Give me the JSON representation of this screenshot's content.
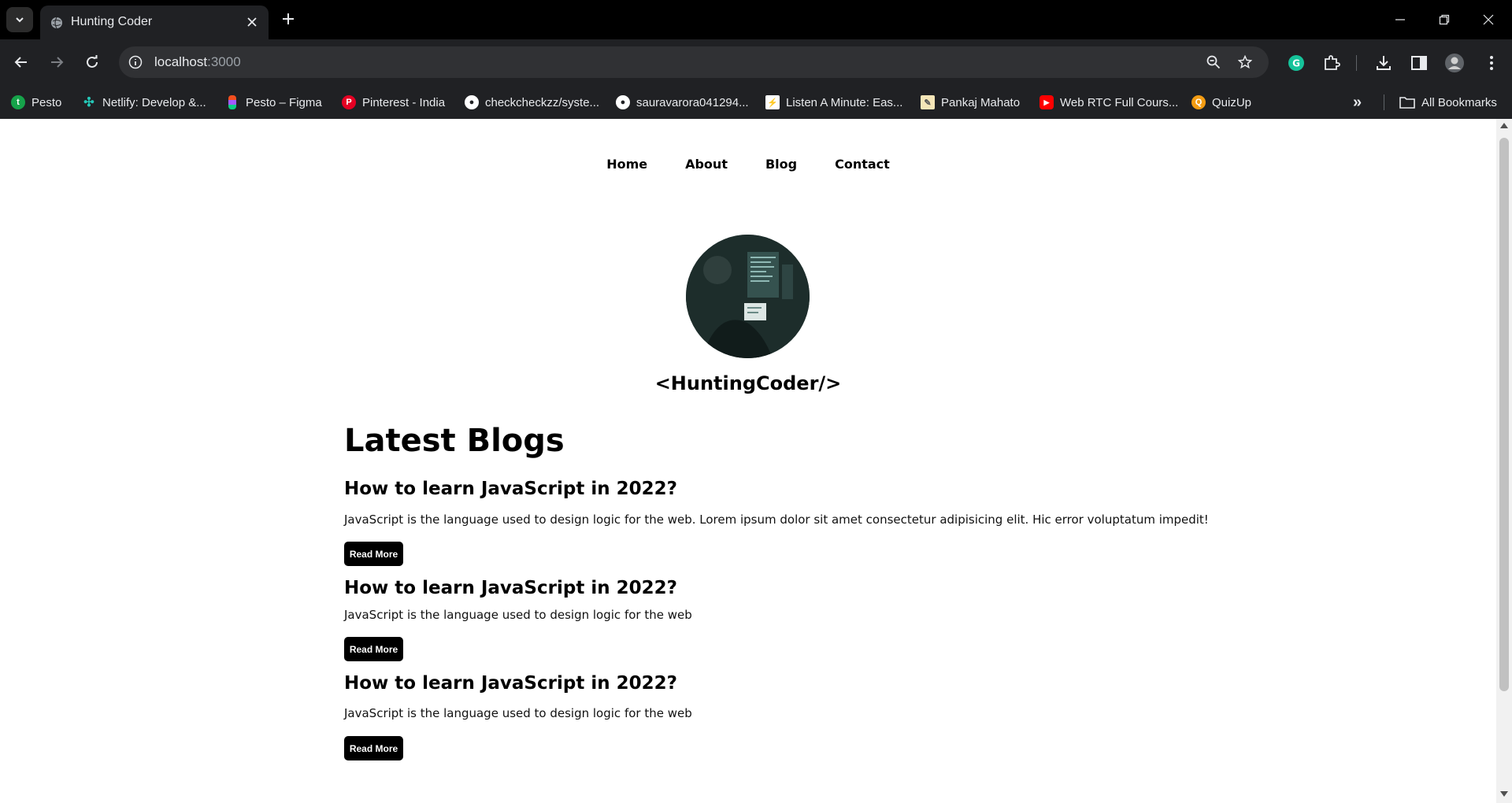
{
  "browser": {
    "tab_title": "Hunting Coder",
    "url_host": "localhost",
    "url_port": ":3000"
  },
  "bookmarks": [
    {
      "label": "Pesto",
      "icon": "pesto-icon",
      "color": "#16a34a"
    },
    {
      "label": "Netlify: Develop &...",
      "icon": "netlify-icon",
      "color": "#25c7b7"
    },
    {
      "label": "Pesto – Figma",
      "icon": "figma-icon",
      "color": "#f24e1e"
    },
    {
      "label": "Pinterest - India",
      "icon": "pinterest-icon",
      "color": "#e60023"
    },
    {
      "label": "checkcheckzz/syste...",
      "icon": "github-icon",
      "color": "#ffffff"
    },
    {
      "label": "sauravarora041294...",
      "icon": "github-icon",
      "color": "#ffffff"
    },
    {
      "label": "Listen A Minute: Eas...",
      "icon": "listen-a-minute-icon",
      "color": "#ffffff"
    },
    {
      "label": "Pankaj Mahato",
      "icon": "document-icon",
      "color": "#f5e6b8"
    },
    {
      "label": "Web RTC Full Cours...",
      "icon": "youtube-icon",
      "color": "#ff0000"
    },
    {
      "label": "QuizUp",
      "icon": "quizup-icon",
      "color": "#f39c12"
    }
  ],
  "all_bookmarks_label": "All Bookmarks",
  "site": {
    "nav": [
      "Home",
      "About",
      "Blog",
      "Contact"
    ],
    "brand": "<HuntingCoder/>",
    "section_title": "Latest Blogs",
    "posts": [
      {
        "title": "How to learn JavaScript in 2022?",
        "excerpt": "JavaScript is the language used to design logic for the web. Lorem ipsum dolor sit amet consectetur adipisicing elit. Hic error voluptatum impedit!",
        "button": "Read More"
      },
      {
        "title": "How to learn JavaScript in 2022?",
        "excerpt": "JavaScript is the language used to design logic for the web",
        "button": "Read More"
      },
      {
        "title": "How to learn JavaScript in 2022?",
        "excerpt": "JavaScript is the language used to design logic for the web",
        "button": "Read More"
      }
    ]
  }
}
